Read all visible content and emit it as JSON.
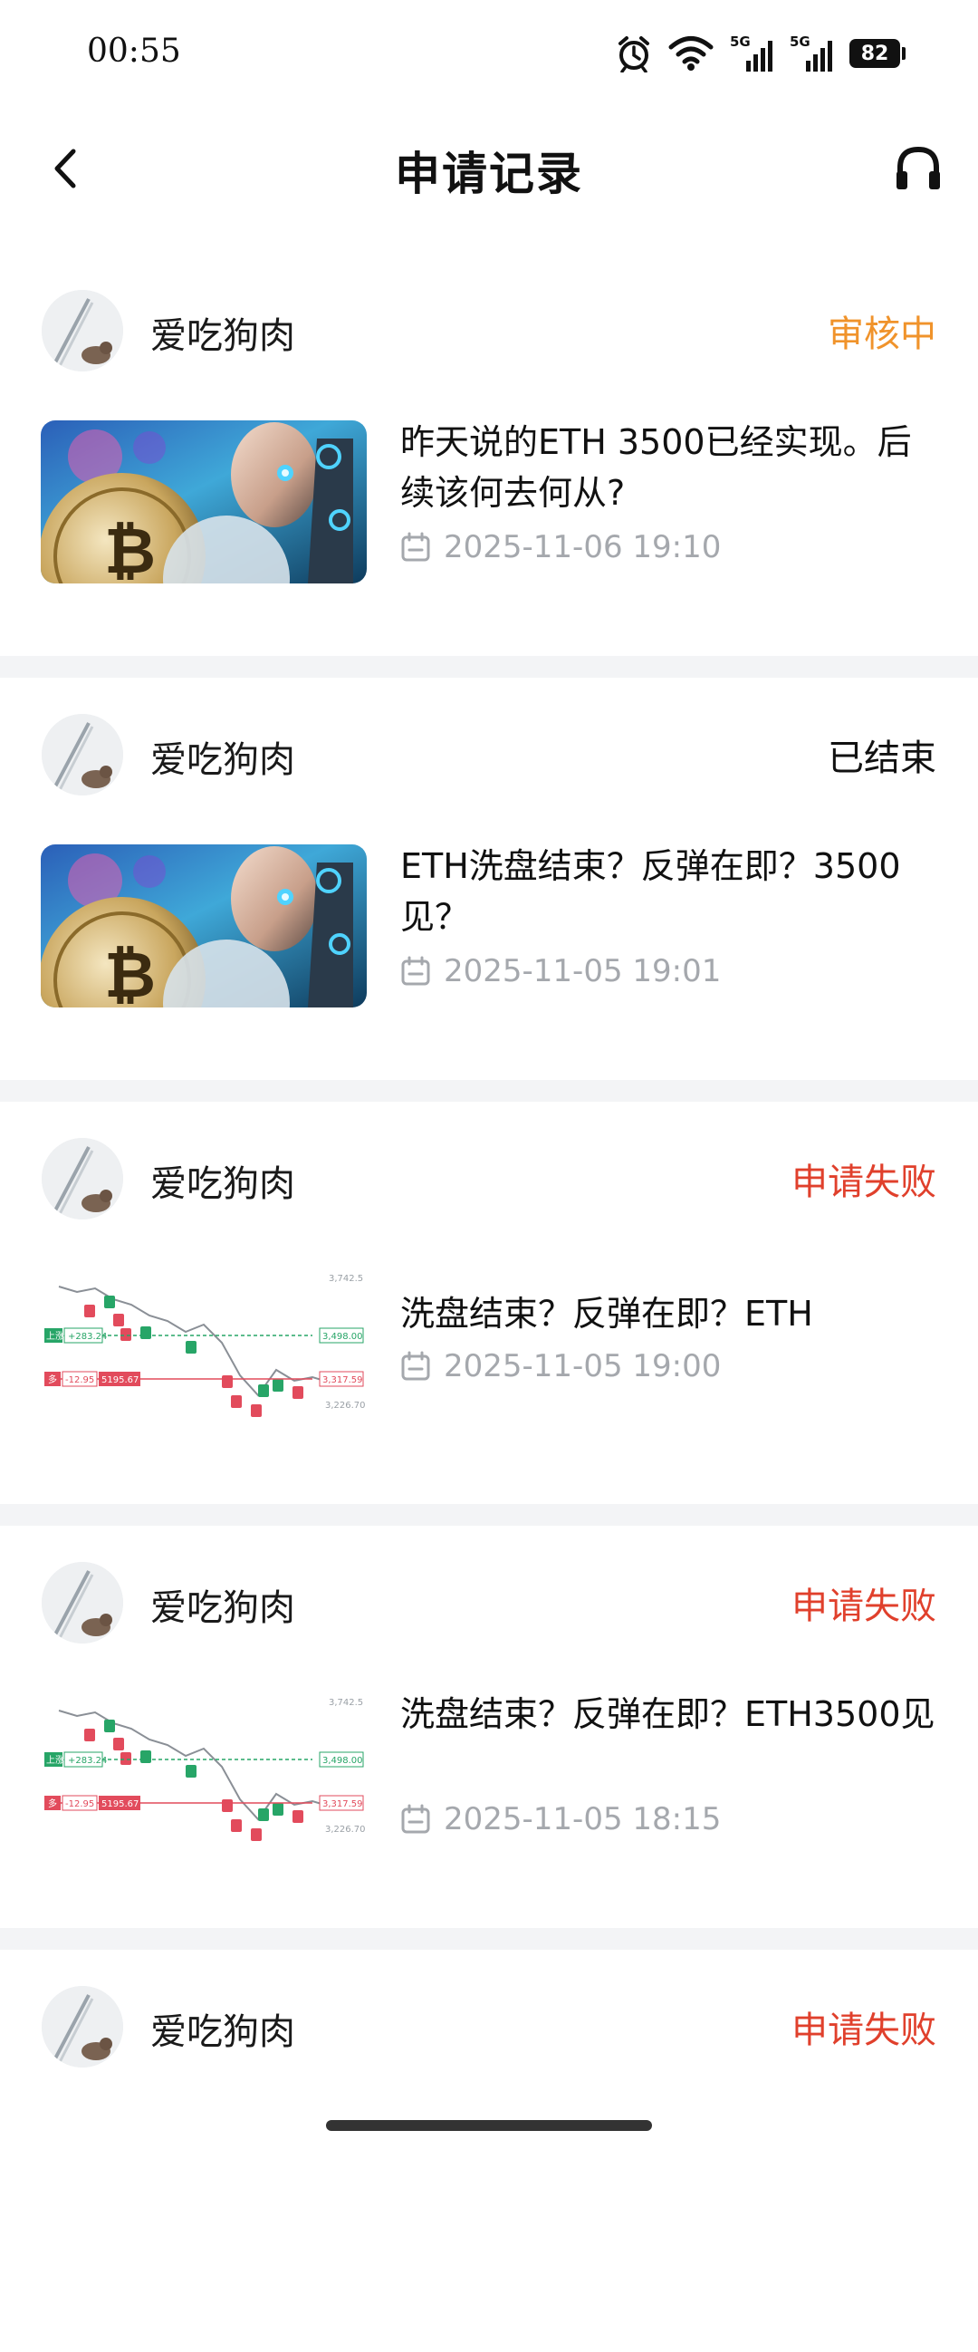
{
  "status_bar": {
    "time": "00:55",
    "network_1": "5G",
    "network_2": "5G",
    "battery": "82"
  },
  "header": {
    "title": "申请记录"
  },
  "records": [
    {
      "user": "爱吃狗肉",
      "status": "审核中",
      "status_color": "#f0932b",
      "title": "昨天说的ETH  3500已经实现。后续该何去何从?",
      "date": "2025-11-06 19:10",
      "thumbnail": "bitcoin-robot"
    },
    {
      "user": "爱吃狗肉",
      "status": "已结束",
      "status_color": "#111111",
      "title": "ETH洗盘结束？反弹在即？3500见？",
      "date": "2025-11-05 19:01",
      "thumbnail": "bitcoin-robot"
    },
    {
      "user": "爱吃狗肉",
      "status": "申请失败",
      "status_color": "#e0402c",
      "title": "洗盘结束？反弹在即？ETH",
      "date": "2025-11-05 19:00",
      "thumbnail": "candlestick-chart"
    },
    {
      "user": "爱吃狗肉",
      "status": "申请失败",
      "status_color": "#e0402c",
      "title": "洗盘结束？反弹在即？ETH3500见",
      "date": "2025-11-05 18:15",
      "thumbnail": "candlestick-chart"
    },
    {
      "user": "爱吃狗肉",
      "status": "申请失败",
      "status_color": "#e0402c"
    }
  ],
  "chart_labels": {
    "top_price": "3,742.5",
    "green_tag": "上涨",
    "green_value": "+283.24",
    "green_price": "3,498.00",
    "red_tag": "多",
    "red_value": "-12.95",
    "red_sub": "5195.67",
    "red_price": "3,317.59",
    "low_price": "3,226.70"
  },
  "icons": {
    "back": "back-arrow-icon",
    "support": "headset-icon",
    "calendar": "calendar-icon",
    "alarm": "alarm-icon",
    "wifi": "wifi-icon",
    "signal": "signal-icon",
    "battery": "battery-icon"
  }
}
